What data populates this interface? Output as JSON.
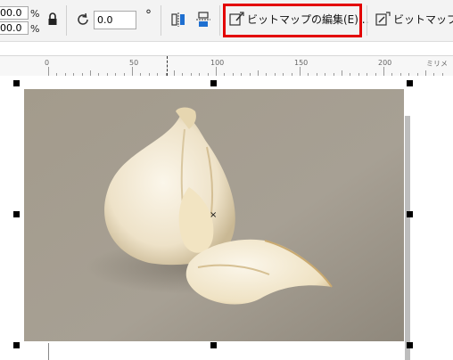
{
  "toolbar": {
    "scale_x_value": "00.0",
    "scale_y_value": "00.0",
    "percent_symbol": "%",
    "rotation_value": "0.0",
    "degree_symbol": "°",
    "edit_bitmap_label": "ビットマップの編集(E)...",
    "trace_bitmap_label": "ビットマップの"
  },
  "ruler": {
    "labels": [
      "0",
      "50",
      "100",
      "150",
      "200"
    ],
    "unit": "ミリメ"
  },
  "colors": {
    "highlight": "#e30000",
    "selection_handle": "#000000"
  },
  "icons": [
    "lock-icon",
    "rotate-icon",
    "mirror-horizontal-icon",
    "mirror-vertical-icon",
    "edit-bitmap-icon",
    "trace-bitmap-icon",
    "center-x-icon"
  ]
}
